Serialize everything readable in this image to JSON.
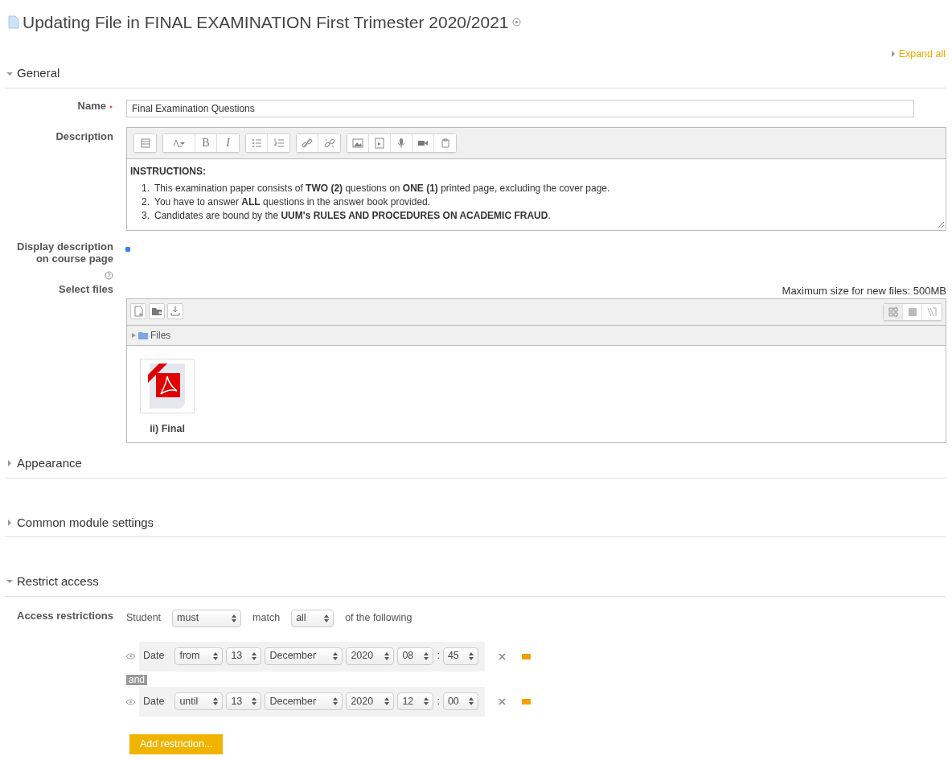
{
  "title": "Updating File in FINAL EXAMINATION First Trimester 2020/2021",
  "expand_all": "Expand all",
  "sections": [
    {
      "kind": "general",
      "title": "General",
      "expanded": true,
      "name_label": "Name",
      "name_required": true,
      "name_value": "Final Examination Questions",
      "description_label": "Description",
      "bold_label": "B",
      "italic_label": "I",
      "description_heading": "INSTRUCTIONS:",
      "description_items": [
        {
          "marker": "1.",
          "text": "This examination paper consists of **TWO (2)** questions on **ONE (1)** printed page, excluding the cover page."
        },
        {
          "marker": "2.",
          "text": "You have to answer **ALL** questions in the answer book provided."
        },
        {
          "marker": "3.",
          "text": "Candidates are bound by the **UUM's RULES AND PROCEDURES ON ACADEMIC FRAUD**."
        }
      ],
      "display_label": "Display description on course page",
      "display_checked": true,
      "files_label": "Select files",
      "max_size": "Maximum size for new files: 500MB",
      "folder": "Files",
      "files": [
        {
          "name": "ii) Final"
        }
      ]
    },
    {
      "kind": "plain",
      "title": "Appearance",
      "expanded": false
    },
    {
      "kind": "plain",
      "title": "Common module settings",
      "expanded": false
    },
    {
      "kind": "restrict",
      "title": "Restrict access",
      "expanded": true,
      "label": "Access restrictions",
      "student": "Student",
      "must": "must",
      "match": "match",
      "all": "all",
      "following": "of the following",
      "conditions": [
        {
          "type": "Date",
          "direction": "from",
          "day": "13",
          "month": "December",
          "year": "2020",
          "hour": "08",
          "separator": ":",
          "minute": "45"
        },
        {
          "type": "Date",
          "direction": "until",
          "day": "13",
          "month": "December",
          "year": "2020",
          "hour": "12",
          "separator": ":",
          "minute": "00"
        }
      ],
      "connector": "and",
      "add_button": "Add restriction..."
    }
  ]
}
